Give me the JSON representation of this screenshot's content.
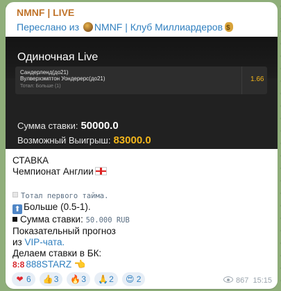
{
  "post": {
    "channel": "NMNF | LIVE",
    "forward_prefix": "Переслано из",
    "forward_source": "NMNF | Клуб Миллиардеров"
  },
  "slip": {
    "title": "Одиночная Live",
    "team1": "Сандерленд(до21)",
    "team2": "Вулверхэмптон Уондерерс(до21)",
    "market": "Тотал: Больше (1)",
    "odds": "1.66",
    "stake_label": "Сумма ставки:",
    "stake_value": "50000.0",
    "win_label": "Возможный Выигрыш:",
    "win_value": "83000.0"
  },
  "message": {
    "l1": "СТАВКА",
    "l2": "Чемпионат Англии",
    "l3": "Тотал первого тайма.",
    "l4": "Больше (0.5-1).",
    "l5_label": "Сумма ставки:",
    "l5_value": "50.000 RUB",
    "l6": "Показательный прогноз",
    "l7_prefix": "из",
    "l7_link": "VIP-чата.",
    "l8": "Делаем ставки в БК:",
    "l9_badge": "8:8",
    "l9_link": "888STARZ"
  },
  "reactions": [
    {
      "icon": "heart-icon",
      "count": "6"
    },
    {
      "icon": "thumbs-up-icon",
      "count": "3"
    },
    {
      "icon": "fire-icon",
      "count": "3"
    },
    {
      "icon": "pray-icon",
      "count": "2"
    },
    {
      "icon": "heart-eyes-icon",
      "count": "2"
    }
  ],
  "meta": {
    "views": "867",
    "time": "15:15"
  }
}
